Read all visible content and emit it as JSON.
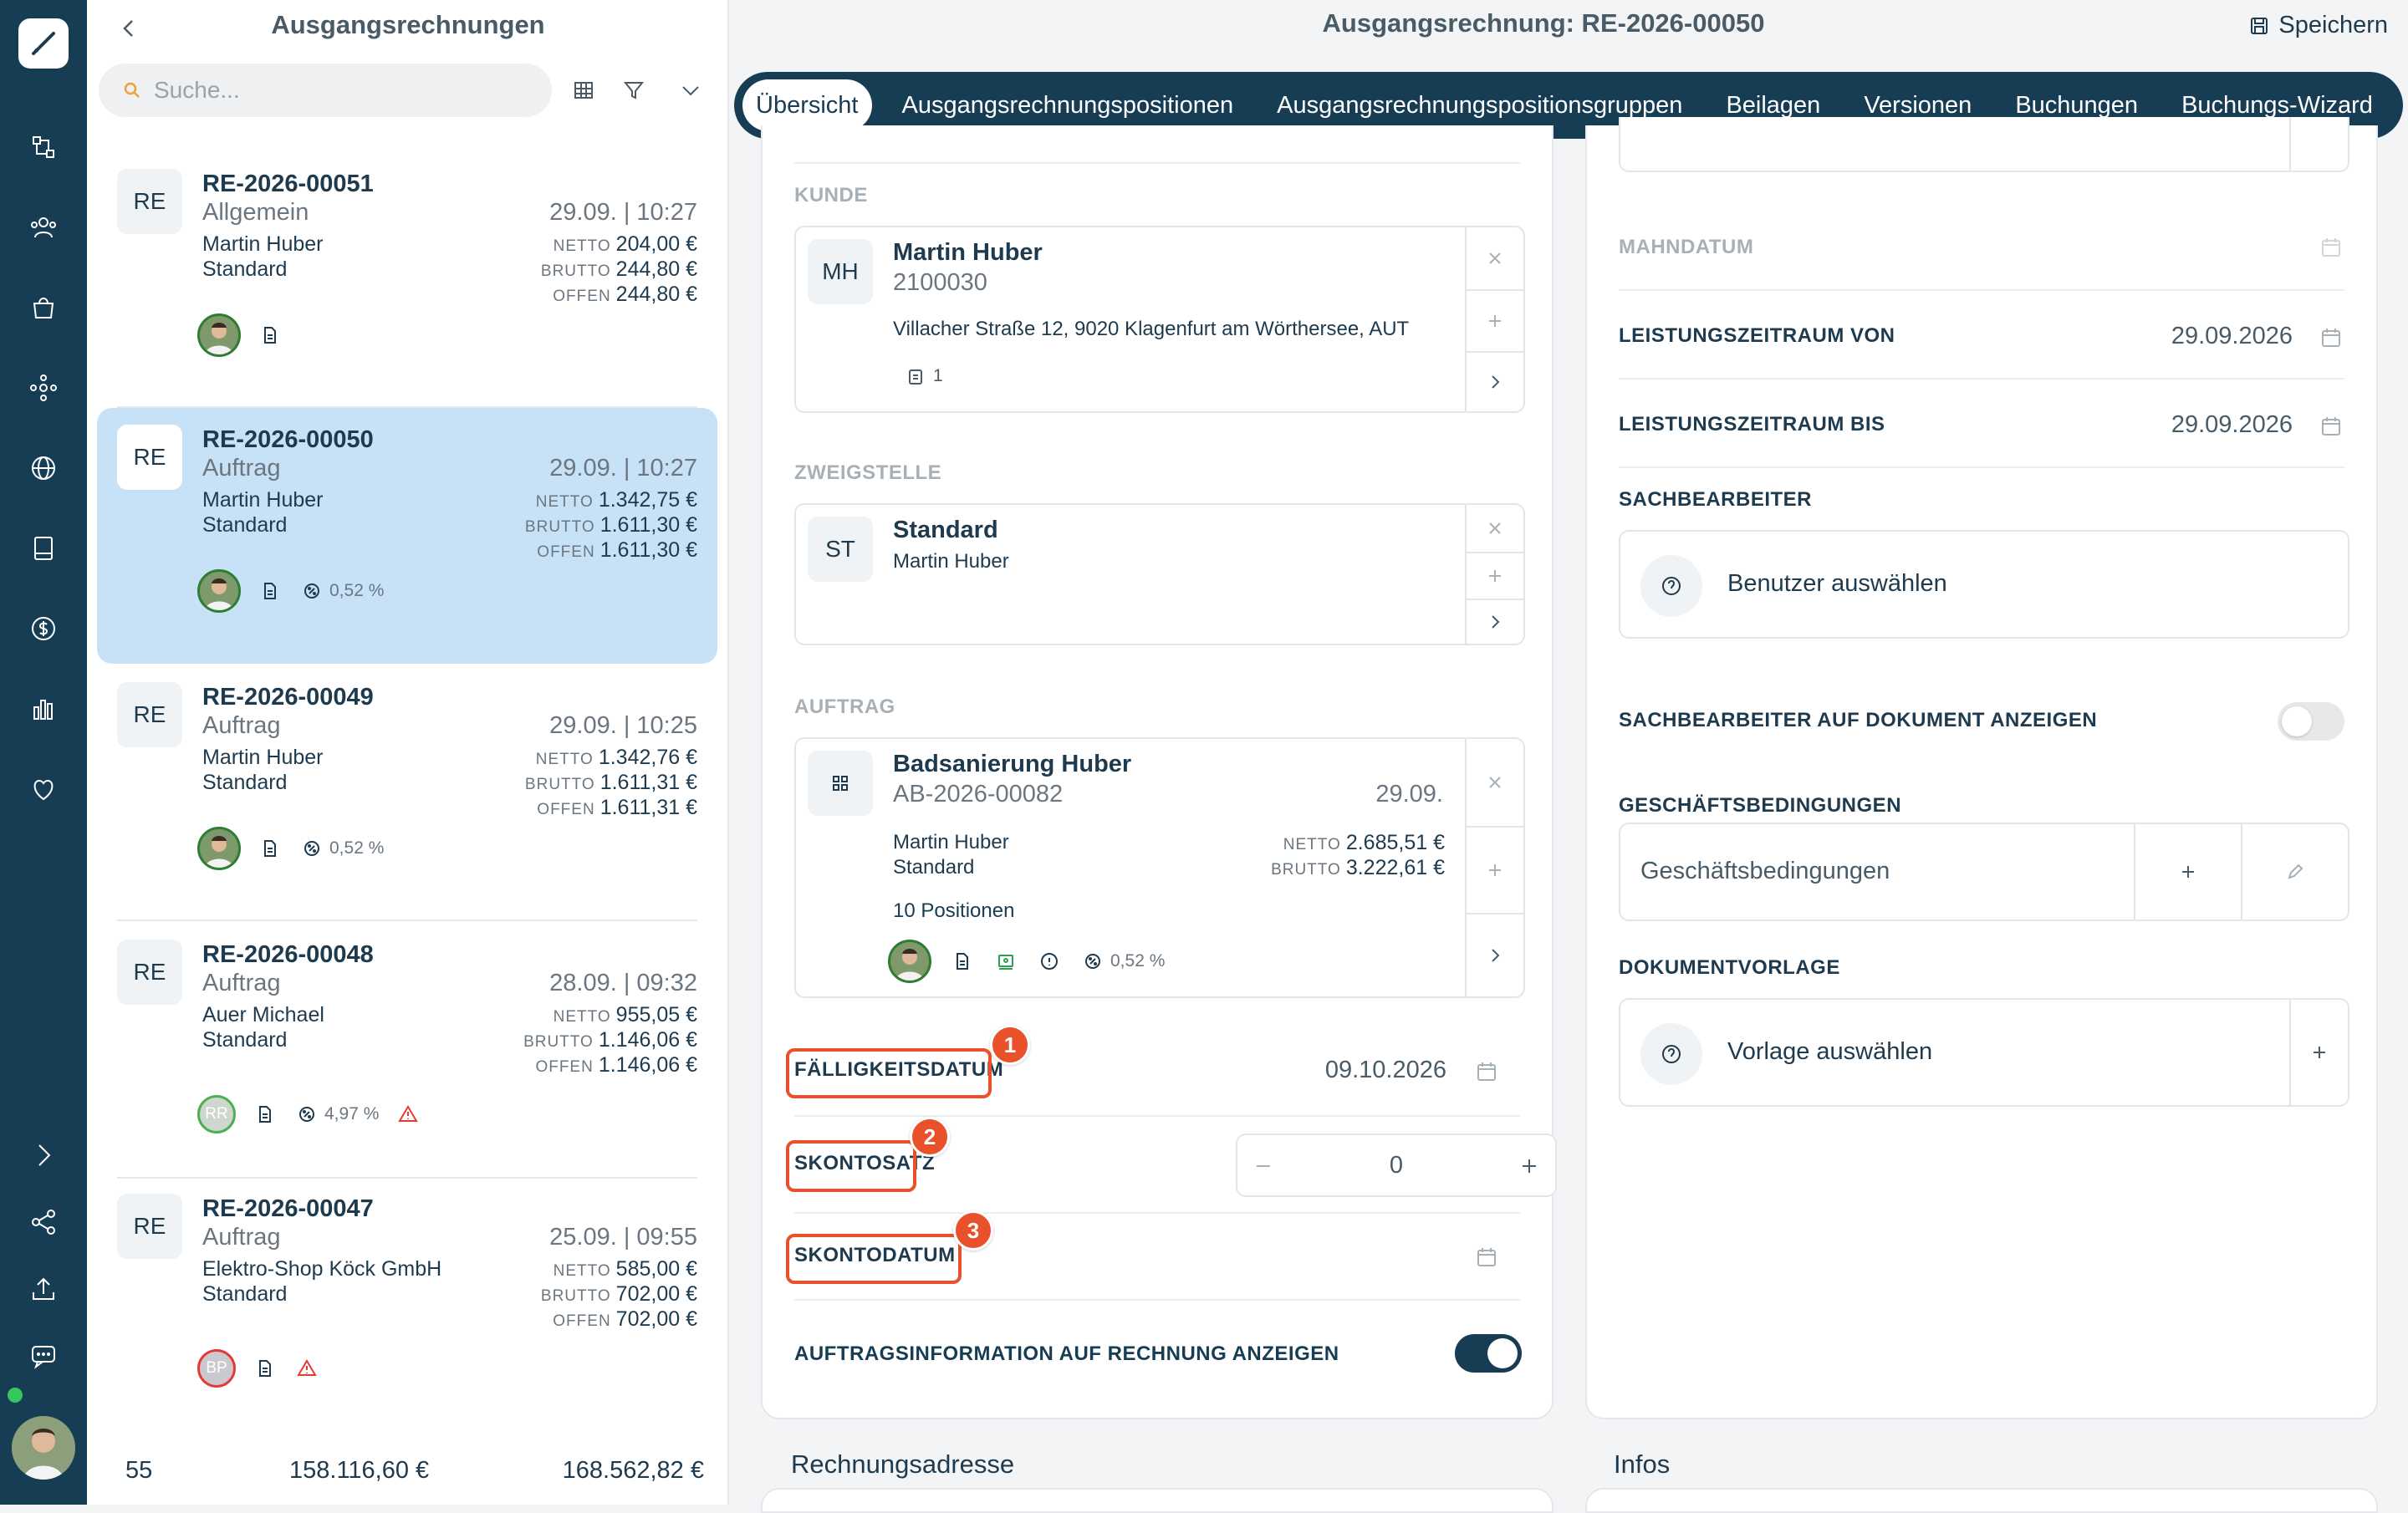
{
  "list": {
    "title": "Ausgangsrechnungen",
    "search_placeholder": "Suche...",
    "cards": [
      {
        "badge": "RE",
        "number": "RE-2026-00051",
        "type": "Allgemein",
        "date": "29.09. | 10:27",
        "customer": "Martin Huber",
        "branch": "Standard",
        "netto_label": "NETTO",
        "netto": "204,00 €",
        "brutto_label": "BRUTTO",
        "brutto": "244,80 €",
        "offen_label": "OFFEN",
        "offen": "244,80 €",
        "pct": ""
      },
      {
        "badge": "RE",
        "number": "RE-2026-00050",
        "type": "Auftrag",
        "date": "29.09. | 10:27",
        "customer": "Martin Huber",
        "branch": "Standard",
        "netto_label": "NETTO",
        "netto": "1.342,75 €",
        "brutto_label": "BRUTTO",
        "brutto": "1.611,30 €",
        "offen_label": "OFFEN",
        "offen": "1.611,30 €",
        "pct": "0,52 %"
      },
      {
        "badge": "RE",
        "number": "RE-2026-00049",
        "type": "Auftrag",
        "date": "29.09. | 10:25",
        "customer": "Martin Huber",
        "branch": "Standard",
        "netto_label": "NETTO",
        "netto": "1.342,76 €",
        "brutto_label": "BRUTTO",
        "brutto": "1.611,31 €",
        "offen_label": "OFFEN",
        "offen": "1.611,31 €",
        "pct": "0,52 %"
      },
      {
        "badge": "RE",
        "number": "RE-2026-00048",
        "type": "Auftrag",
        "date": "28.09. | 09:32",
        "customer": "Auer Michael",
        "branch": "Standard",
        "netto_label": "NETTO",
        "netto": "955,05 €",
        "brutto_label": "BRUTTO",
        "brutto": "1.146,06 €",
        "offen_label": "OFFEN",
        "offen": "1.146,06 €",
        "pct": "4,97 %",
        "avatar_initials": "RR"
      },
      {
        "badge": "RE",
        "number": "RE-2026-00047",
        "type": "Auftrag",
        "date": "25.09. | 09:55",
        "customer": "Elektro-Shop Köck GmbH",
        "branch": "Standard",
        "netto_label": "NETTO",
        "netto": "585,00 €",
        "brutto_label": "BRUTTO",
        "brutto": "702,00 €",
        "offen_label": "OFFEN",
        "offen": "702,00 €",
        "pct": "",
        "avatar_initials": "BP"
      }
    ],
    "footer": {
      "count": "55",
      "netto_total": "158.116,60 €",
      "brutto_total": "168.562,82 €"
    }
  },
  "detail": {
    "title": "Ausgangsrechnung: RE-2026-00050",
    "save_label": "Speichern",
    "tabs": [
      "Übersicht",
      "Ausgangsrechnungspositionen",
      "Ausgangsrechnungspositionsgruppen",
      "Beilagen",
      "Versionen",
      "Buchungen",
      "Buchungs-Wizard"
    ],
    "kunde": {
      "label": "KUNDE",
      "badge": "MH",
      "name": "Martin Huber",
      "number": "2100030",
      "address": "Villacher Straße 12, 9020 Klagenfurt am Wörthersee, AUT",
      "docs": "1"
    },
    "zweigstelle": {
      "label": "ZWEIGSTELLE",
      "badge": "ST",
      "name": "Standard",
      "contact": "Martin Huber"
    },
    "auftrag": {
      "label": "AUFTRAG",
      "name": "Badsanierung Huber",
      "number": "AB-2026-00082",
      "date": "29.09.",
      "customer": "Martin Huber",
      "branch": "Standard",
      "netto_label": "NETTO",
      "netto": "2.685,51 €",
      "brutto_label": "BRUTTO",
      "brutto": "3.222,61 €",
      "positions": "10 Positionen",
      "pct": "0,52 %"
    },
    "faelligkeit": {
      "label": "FÄLLIGKEITSDATUM",
      "value": "09.10.2026",
      "marker": "1"
    },
    "skontosatz": {
      "label": "SKONTOSATZ",
      "value": "0",
      "marker": "2"
    },
    "skontodatum": {
      "label": "SKONTODATUM",
      "value": "",
      "marker": "3"
    },
    "auftragsinfo": {
      "label": "AUFTRAGSINFORMATION AUF RECHNUNG ANZEIGEN",
      "on": true
    },
    "mahndatum": {
      "label": "MAHNDATUM"
    },
    "leistung_von": {
      "label": "LEISTUNGSZEITRAUM VON",
      "value": "29.09.2026"
    },
    "leistung_bis": {
      "label": "LEISTUNGSZEITRAUM BIS",
      "value": "29.09.2026"
    },
    "sachbearbeiter": {
      "label": "SACHBEARBEITER",
      "placeholder": "Benutzer auswählen"
    },
    "sachbearbeiter_anzeigen": {
      "label": "SACHBEARBEITER AUF DOKUMENT ANZEIGEN",
      "on": false
    },
    "geschaeftsbedingungen": {
      "label": "GESCHÄFTSBEDINGUNGEN",
      "placeholder": "Geschäftsbedingungen"
    },
    "dokumentvorlage": {
      "label": "DOKUMENTVORLAGE",
      "placeholder": "Vorlage auswählen"
    },
    "section_rechnungsadresse": "Rechnungsadresse",
    "section_infos": "Infos"
  },
  "colors": {
    "rail": "#173d54",
    "selected": "#c7e1f7",
    "highlight": "#e8512a"
  }
}
